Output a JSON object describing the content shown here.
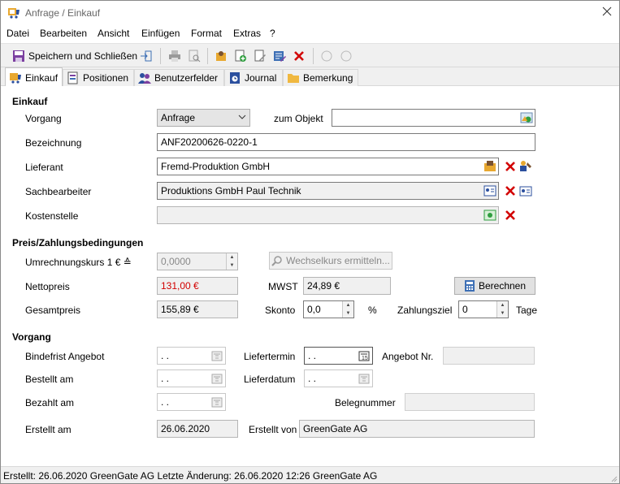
{
  "window": {
    "title": "Anfrage / Einkauf"
  },
  "menu": {
    "items": [
      "Datei",
      "Bearbeiten",
      "Ansicht",
      "Einfügen",
      "Format",
      "Extras",
      "?"
    ]
  },
  "toolbar": {
    "save_close_label": "Speichern und Schließen"
  },
  "tabs": [
    "Einkauf",
    "Positionen",
    "Benutzerfelder",
    "Journal",
    "Bemerkung"
  ],
  "einkauf": {
    "section_title": "Einkauf",
    "vorgang_label": "Vorgang",
    "vorgang_value": "Anfrage",
    "zum_objekt_label": "zum Objekt",
    "zum_objekt_value": "",
    "bezeichnung_label": "Bezeichnung",
    "bezeichnung_value": "ANF20200626-0220-1",
    "lieferant_label": "Lieferant",
    "lieferant_value": "Fremd-Produktion GmbH",
    "sachbearbeiter_label": "Sachbearbeiter",
    "sachbearbeiter_value": "Produktions GmbH  Paul Technik",
    "kostenstelle_label": "Kostenstelle",
    "kostenstelle_value": ""
  },
  "preis": {
    "section_title": "Preis/Zahlungsbedingungen",
    "kurs_label": "Umrechnungskurs 1 € ≙",
    "kurs_value": "0,0000",
    "wechselkurs_button": "Wechselkurs ermitteln...",
    "netto_label": "Nettopreis",
    "netto_value": "131,00 €",
    "mwst_label": "MWST",
    "mwst_value": "24,89 €",
    "berechnen_button": "Berechnen",
    "gesamt_label": "Gesamtpreis",
    "gesamt_value": "155,89 €",
    "skonto_label": "Skonto",
    "skonto_value": "0,0",
    "percent": "%",
    "zahlungsziel_label": "Zahlungsziel",
    "zahlungsziel_value": "0",
    "tage": "Tage"
  },
  "vorgang": {
    "section_title": "Vorgang",
    "bindefrist_label": "Bindefrist Angebot",
    "bindefrist_value": " .  .",
    "liefertermin_label": "Liefertermin",
    "liefertermin_value": " .  .",
    "angebot_nr_label": "Angebot Nr.",
    "angebot_nr_value": "",
    "bestellt_label": "Bestellt am",
    "bestellt_value": " .  .",
    "lieferdatum_label": "Lieferdatum",
    "lieferdatum_value": " .  .",
    "bezahlt_label": "Bezahlt am",
    "bezahlt_value": " .  .",
    "belegnummer_label": "Belegnummer",
    "belegnummer_value": "",
    "erstellt_label": "Erstellt am",
    "erstellt_value": "26.06.2020",
    "erstellt_von_label": "Erstellt von",
    "erstellt_von_value": "GreenGate AG"
  },
  "status": {
    "text": "Erstellt: 26.06.2020 GreenGate AG  Letzte Änderung: 26.06.2020 12:26 GreenGate AG"
  },
  "colors": {
    "accent": "#d20000",
    "field_readonly": "#f0f0f0",
    "chrome": "#f0f0f0"
  }
}
